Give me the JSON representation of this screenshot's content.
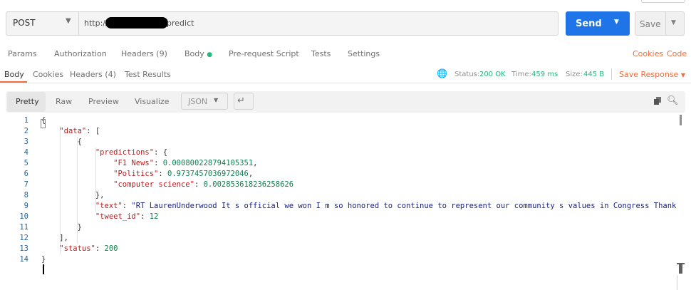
{
  "request": {
    "method": "POST",
    "url_prefix": "http://",
    "url_suffix": "predict",
    "send_label": "Send",
    "save_label": "Save"
  },
  "request_tabs": {
    "params": "Params",
    "authorization": "Authorization",
    "headers": "Headers (9)",
    "body": "Body",
    "prerequest": "Pre-request Script",
    "tests": "Tests",
    "settings": "Settings",
    "cookies": "Cookies",
    "code": "Code"
  },
  "response_tabs": {
    "body": "Body",
    "cookies": "Cookies",
    "headers": "Headers (4)",
    "test_results": "Test Results"
  },
  "status": {
    "status_label": "Status:",
    "status_value": "200 OK",
    "time_label": "Time:",
    "time_value": "459 ms",
    "size_label": "Size:",
    "size_value": "445 B",
    "save_response": "Save Response"
  },
  "viewer": {
    "pretty": "Pretty",
    "raw": "Raw",
    "preview": "Preview",
    "visualize": "Visualize",
    "format": "JSON"
  },
  "code": {
    "line_numbers": [
      "1",
      "2",
      "3",
      "4",
      "5",
      "6",
      "7",
      "8",
      "9",
      "10",
      "11",
      "12",
      "13",
      "14"
    ],
    "data_key": "\"data\"",
    "predictions_key": "\"predictions\"",
    "f1_key": "\"F1 News\"",
    "f1_val": "0.000800228794105351",
    "politics_key": "\"Politics\"",
    "politics_val": "0.9737457036972046",
    "cs_key": "\"computer science\"",
    "cs_val": "0.002853618236258626",
    "text_key": "\"text\"",
    "text_val": "\"RT LaurenUnderwood It s official we won I m so honored to continue to represent our community s values in Congress Thank",
    "tweet_key": "\"tweet_id\"",
    "tweet_val": "12",
    "status_key": "\"status\"",
    "status_val": "200"
  },
  "colors": {
    "send": "#1f75e8",
    "accent": "#f26b3a",
    "ok": "#26b47f"
  }
}
